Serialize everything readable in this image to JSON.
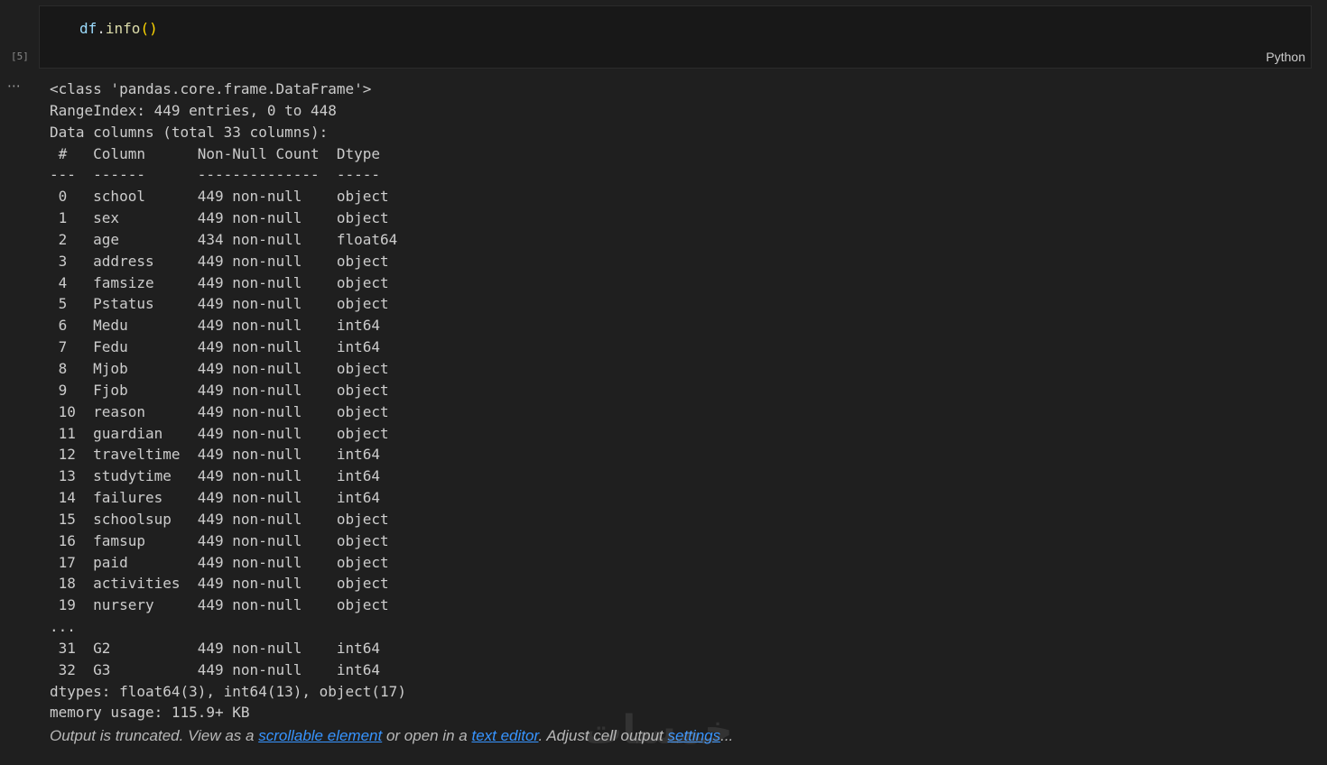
{
  "cell": {
    "execution_count": "[5]",
    "code": {
      "var": "df",
      "dot": ".",
      "method": "info",
      "parens": "()"
    },
    "language": "Python"
  },
  "output": {
    "menu_icon": "ellipsis-icon",
    "menu_glyph": "⋯",
    "lines": [
      "<class 'pandas.core.frame.DataFrame'>",
      "RangeIndex: 449 entries, 0 to 448",
      "Data columns (total 33 columns):",
      " #   Column      Non-Null Count  Dtype  ",
      "---  ------      --------------  -----  ",
      " 0   school      449 non-null    object ",
      " 1   sex         449 non-null    object ",
      " 2   age         434 non-null    float64",
      " 3   address     449 non-null    object ",
      " 4   famsize     449 non-null    object ",
      " 5   Pstatus     449 non-null    object ",
      " 6   Medu        449 non-null    int64  ",
      " 7   Fedu        449 non-null    int64  ",
      " 8   Mjob        449 non-null    object ",
      " 9   Fjob        449 non-null    object ",
      " 10  reason      449 non-null    object ",
      " 11  guardian    449 non-null    object ",
      " 12  traveltime  449 non-null    int64  ",
      " 13  studytime   449 non-null    int64  ",
      " 14  failures    449 non-null    int64  ",
      " 15  schoolsup   449 non-null    object ",
      " 16  famsup      449 non-null    object ",
      " 17  paid        449 non-null    object ",
      " 18  activities  449 non-null    object ",
      " 19  nursery     449 non-null    object ",
      "...",
      " 31  G2          449 non-null    int64  ",
      " 32  G3          449 non-null    int64  ",
      "dtypes: float64(3), int64(13), object(17)",
      "memory usage: 115.9+ KB"
    ],
    "truncated": {
      "prefix": "Output is truncated. View as a ",
      "link1": "scrollable element",
      "middle": " or open in a ",
      "link2": "text editor",
      "middle2": ". Adjust cell output ",
      "link3": "settings",
      "suffix": "..."
    }
  },
  "watermark": "خمسات",
  "colors": {
    "background": "#1f1f1f",
    "cell_background": "#181818",
    "text": "#cccccc",
    "link": "#3794ff",
    "code_variable": "#9cdcfe",
    "code_function": "#dcdcaa",
    "code_bracket": "#ffd700"
  }
}
